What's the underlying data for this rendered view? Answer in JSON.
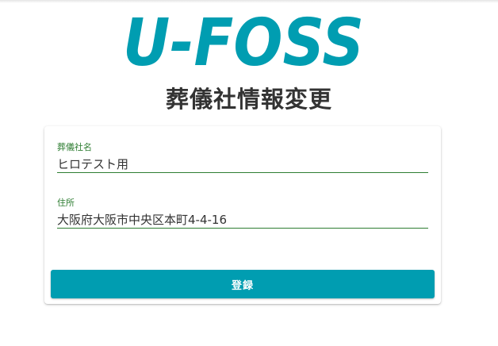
{
  "logo": {
    "text": "U-FOSS",
    "color": "#009db1"
  },
  "page_title": "葬儀社情報変更",
  "form": {
    "fields": [
      {
        "label": "葬儀社名",
        "value": "ヒロテスト用"
      },
      {
        "label": "住所",
        "value": "大阪府大阪市中央区本町4-4-16"
      }
    ],
    "submit_label": "登録"
  },
  "colors": {
    "accent": "#009db1",
    "field_label": "#2e7d32",
    "title_text": "#333333"
  }
}
